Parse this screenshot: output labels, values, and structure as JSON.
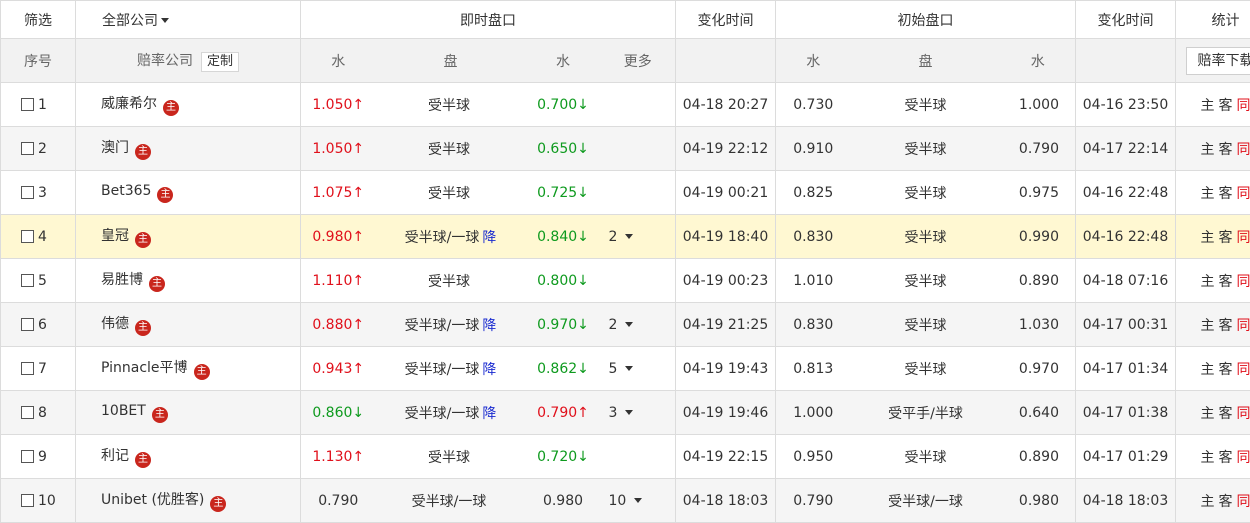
{
  "header": {
    "filter": "筛选",
    "company_filter": "全部公司",
    "live": "即时盘口",
    "change_time": "变化时间",
    "initial": "初始盘口",
    "change_time2": "变化时间",
    "stats": "统计"
  },
  "subheader": {
    "index": "序号",
    "company": "赔率公司",
    "custom_btn": "定制",
    "water1": "水",
    "handicap": "盘",
    "water2": "水",
    "more": "更多",
    "init_water1": "水",
    "init_handicap": "盘",
    "init_water2": "水",
    "download_btn": "赔率下载"
  },
  "icon_glyph": "主",
  "stat_labels": {
    "home": "主",
    "away": "客",
    "same": "同"
  },
  "colors": {
    "up": "#e0101b",
    "down": "#0e9a1e",
    "drop": "#1a2bd0",
    "icon": "#c9261d",
    "highlight": "#fff8d2"
  },
  "rows": [
    {
      "index": "1",
      "company": "威廉希尔",
      "w1": "1.050",
      "w1_dir": "up",
      "arrow1": "↑",
      "hc": "受半球",
      "drop": "",
      "w2": "0.700",
      "w2_dir": "down",
      "arrow2": "↓",
      "more": "",
      "time": "04-18 20:27",
      "iw1": "0.730",
      "ihc": "受半球",
      "iw2": "1.000",
      "itime": "04-16 23:50"
    },
    {
      "index": "2",
      "company": "澳门",
      "w1": "1.050",
      "w1_dir": "up",
      "arrow1": "↑",
      "hc": "受半球",
      "drop": "",
      "w2": "0.650",
      "w2_dir": "down",
      "arrow2": "↓",
      "more": "",
      "time": "04-19 22:12",
      "iw1": "0.910",
      "ihc": "受半球",
      "iw2": "0.790",
      "itime": "04-17 22:14"
    },
    {
      "index": "3",
      "company": "Bet365",
      "w1": "1.075",
      "w1_dir": "up",
      "arrow1": "↑",
      "hc": "受半球",
      "drop": "",
      "w2": "0.725",
      "w2_dir": "down",
      "arrow2": "↓",
      "more": "",
      "time": "04-19 00:21",
      "iw1": "0.825",
      "ihc": "受半球",
      "iw2": "0.975",
      "itime": "04-16 22:48"
    },
    {
      "index": "4",
      "company": "皇冠",
      "w1": "0.980",
      "w1_dir": "up",
      "arrow1": "↑",
      "hc": "受半球/一球",
      "drop": "降",
      "w2": "0.840",
      "w2_dir": "down",
      "arrow2": "↓",
      "more": "2",
      "time": "04-19 18:40",
      "iw1": "0.830",
      "ihc": "受半球",
      "iw2": "0.990",
      "itime": "04-16 22:48"
    },
    {
      "index": "5",
      "company": "易胜博",
      "w1": "1.110",
      "w1_dir": "up",
      "arrow1": "↑",
      "hc": "受半球",
      "drop": "",
      "w2": "0.800",
      "w2_dir": "down",
      "arrow2": "↓",
      "more": "",
      "time": "04-19 00:23",
      "iw1": "1.010",
      "ihc": "受半球",
      "iw2": "0.890",
      "itime": "04-18 07:16"
    },
    {
      "index": "6",
      "company": "伟德",
      "w1": "0.880",
      "w1_dir": "up",
      "arrow1": "↑",
      "hc": "受半球/一球",
      "drop": "降",
      "w2": "0.970",
      "w2_dir": "down",
      "arrow2": "↓",
      "more": "2",
      "time": "04-19 21:25",
      "iw1": "0.830",
      "ihc": "受半球",
      "iw2": "1.030",
      "itime": "04-17 00:31"
    },
    {
      "index": "7",
      "company": "Pinnacle平博",
      "w1": "0.943",
      "w1_dir": "up",
      "arrow1": "↑",
      "hc": "受半球/一球",
      "drop": "降",
      "w2": "0.862",
      "w2_dir": "down",
      "arrow2": "↓",
      "more": "5",
      "time": "04-19 19:43",
      "iw1": "0.813",
      "ihc": "受半球",
      "iw2": "0.970",
      "itime": "04-17 01:34"
    },
    {
      "index": "8",
      "company": "10BET",
      "w1": "0.860",
      "w1_dir": "down",
      "arrow1": "↓",
      "hc": "受半球/一球",
      "drop": "降",
      "w2": "0.790",
      "w2_dir": "up",
      "arrow2": "↑",
      "more": "3",
      "time": "04-19 19:46",
      "iw1": "1.000",
      "ihc": "受平手/半球",
      "iw2": "0.640",
      "itime": "04-17 01:38"
    },
    {
      "index": "9",
      "company": "利记",
      "w1": "1.130",
      "w1_dir": "up",
      "arrow1": "↑",
      "hc": "受半球",
      "drop": "",
      "w2": "0.720",
      "w2_dir": "down",
      "arrow2": "↓",
      "more": "",
      "time": "04-19 22:15",
      "iw1": "0.950",
      "ihc": "受半球",
      "iw2": "0.890",
      "itime": "04-17 01:29"
    },
    {
      "index": "10",
      "company": "Unibet (优胜客)",
      "w1": "0.790",
      "w1_dir": "neutral",
      "arrow1": "",
      "hc": "受半球/一球",
      "drop": "",
      "w2": "0.980",
      "w2_dir": "neutral",
      "arrow2": "",
      "more": "10",
      "time": "04-18 18:03",
      "iw1": "0.790",
      "ihc": "受半球/一球",
      "iw2": "0.980",
      "itime": "04-18 18:03"
    }
  ]
}
